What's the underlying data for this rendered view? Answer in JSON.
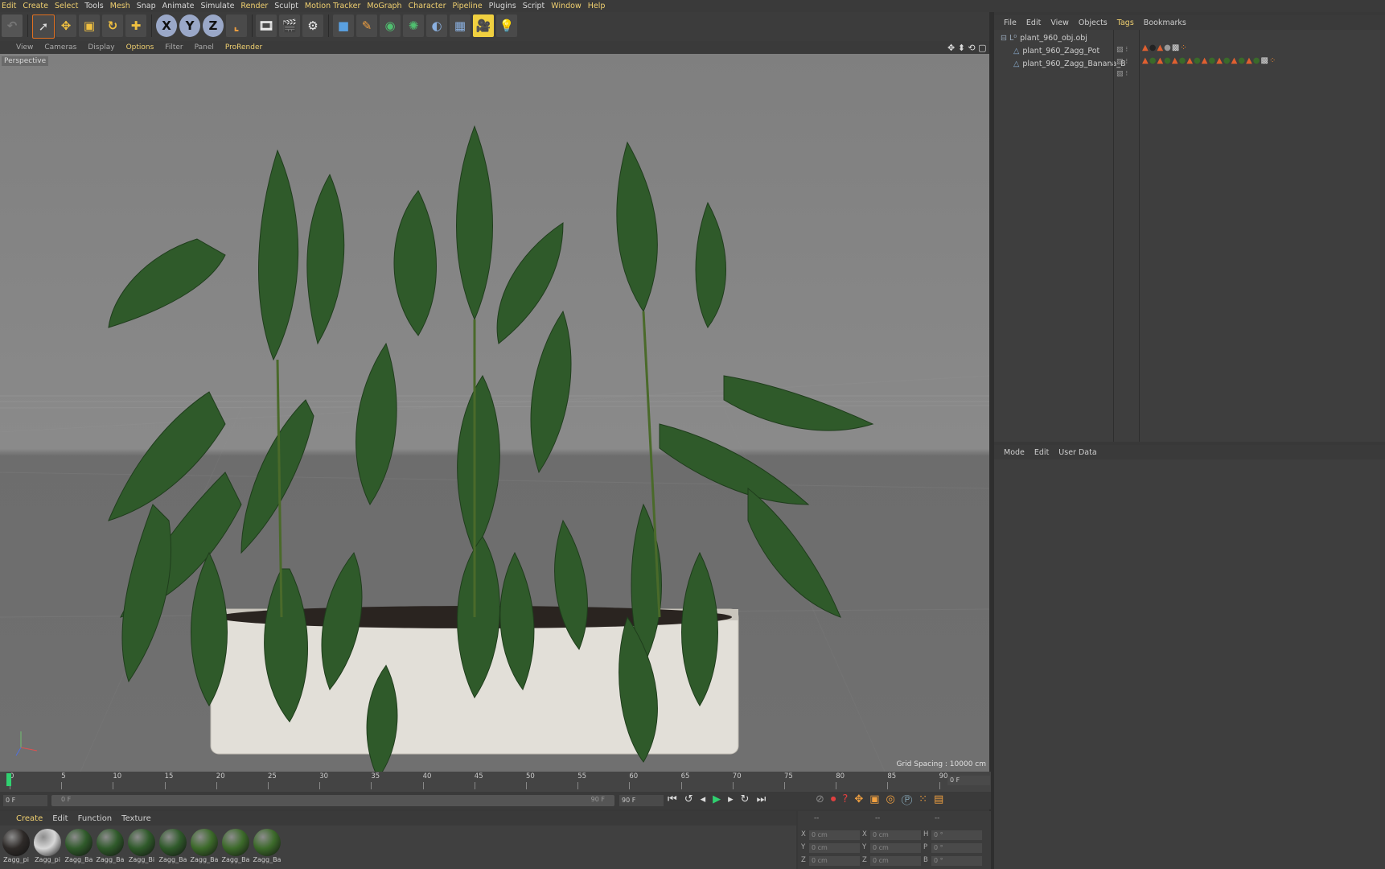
{
  "menu": [
    "Edit",
    "Create",
    "Select",
    "Tools",
    "Mesh",
    "Snap",
    "Animate",
    "Simulate",
    "Render",
    "Sculpt",
    "Motion Tracker",
    "MoGraph",
    "Character",
    "Pipeline",
    "Plugins",
    "Script",
    "Window",
    "Help"
  ],
  "toolbar": {
    "axis_x": "X",
    "axis_y": "Y",
    "axis_z": "Z"
  },
  "viewport_menu": [
    "View",
    "Cameras",
    "Display",
    "Options",
    "Filter",
    "Panel",
    "ProRender"
  ],
  "viewport": {
    "label": "Perspective",
    "grid_spacing": "Grid Spacing : 10000 cm"
  },
  "object_manager": {
    "menu": [
      "File",
      "Edit",
      "View",
      "Objects",
      "Tags",
      "Bookmarks"
    ],
    "objects": [
      {
        "name": "plant_960_obj.obj",
        "level": 0
      },
      {
        "name": "plant_960_Zagg_Pot",
        "level": 1
      },
      {
        "name": "plant_960_Zagg_Banana_B",
        "level": 1
      }
    ]
  },
  "attribute_manager": {
    "menu": [
      "Mode",
      "Edit",
      "User Data"
    ]
  },
  "timeline": {
    "ticks": [
      "0",
      "5",
      "10",
      "15",
      "20",
      "25",
      "30",
      "35",
      "40",
      "45",
      "50",
      "55",
      "60",
      "65",
      "70",
      "75",
      "80",
      "85",
      "90"
    ],
    "current_frame_field": "0 F",
    "start_field": "0 F",
    "range_start": "0 F",
    "range_end": "90 F",
    "end_field": "90 F"
  },
  "material_manager": {
    "menu": [
      "Create",
      "Edit",
      "Function",
      "Texture"
    ],
    "materials": [
      {
        "label": "Zagg_pi",
        "color": "#2e2a28"
      },
      {
        "label": "Zagg_pi",
        "color": "#d8d8d8"
      },
      {
        "label": "Zagg_Ba",
        "color": "#2f5a2a"
      },
      {
        "label": "Zagg_Ba",
        "color": "#2f5a2a"
      },
      {
        "label": "Zagg_Bi",
        "color": "#2f5a2a"
      },
      {
        "label": "Zagg_Ba",
        "color": "#2f5a2a"
      },
      {
        "label": "Zagg_Ba",
        "color": "#3c6a2a"
      },
      {
        "label": "Zagg_Ba",
        "color": "#3c6a2a"
      },
      {
        "label": "Zagg_Ba",
        "color": "#3c6a2a"
      }
    ]
  },
  "coordinates": {
    "headers": [
      "--",
      "--",
      "--"
    ],
    "rows": [
      {
        "a": "X",
        "av": "0 cm",
        "b": "X",
        "bv": "0 cm",
        "c": "H",
        "cv": "0 °"
      },
      {
        "a": "Y",
        "av": "0 cm",
        "b": "Y",
        "bv": "0 cm",
        "c": "P",
        "cv": "0 °"
      },
      {
        "a": "Z",
        "av": "0 cm",
        "b": "Z",
        "bv": "0 cm",
        "c": "B",
        "cv": "0 °"
      }
    ]
  },
  "colors": {
    "accent": "#f0d070",
    "panel": "#3e3e3e",
    "leaf": "#2f5a2a",
    "pot": "#e2dfd8"
  }
}
